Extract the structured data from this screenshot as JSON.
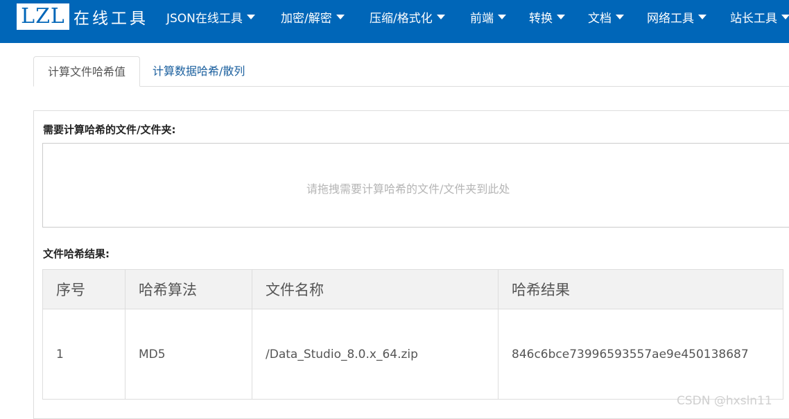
{
  "header": {
    "logo_box": "LZL",
    "logo_text": "在线工具",
    "nav": [
      {
        "label": "JSON在线工具"
      },
      {
        "label": "加密/解密"
      },
      {
        "label": "压缩/格式化"
      },
      {
        "label": "前端"
      },
      {
        "label": "转换"
      },
      {
        "label": "文档"
      },
      {
        "label": "网络工具"
      },
      {
        "label": "站长工具"
      }
    ]
  },
  "tabs": [
    {
      "label": "计算文件哈希值",
      "active": true
    },
    {
      "label": "计算数据哈希/散列",
      "active": false
    }
  ],
  "upload": {
    "label": "需要计算哈希的文件/文件夹:",
    "hint": "请拖拽需要计算哈希的文件/文件夹到此处"
  },
  "results": {
    "label": "文件哈希结果:",
    "columns": [
      "序号",
      "哈希算法",
      "文件名称",
      "哈希结果"
    ],
    "rows": [
      [
        "1",
        "MD5",
        "/Data_Studio_8.0.x_64.zip",
        "846c6bce73996593557ae9e450138687"
      ]
    ]
  },
  "watermark": "CSDN @hxsln11",
  "colors": {
    "brand": "#0066b8",
    "link": "#1a5f9e"
  }
}
